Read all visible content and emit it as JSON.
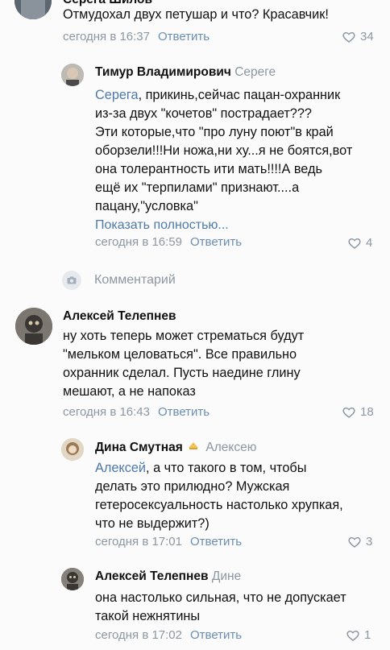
{
  "c1": {
    "author": "Серега Шилов",
    "text": "Отмудохал двух петушар и что? Красавчик!",
    "time": "сегодня в 16:37",
    "reply_label": "Ответить",
    "likes": "34"
  },
  "c2": {
    "author": "Тимур Владимирович",
    "reply_to": "Сереге",
    "mention": "Серега",
    "text_lines": [
      ", прикинь,сейчас пацан-охранник",
      "из-за двух \"кочетов\" пострадает???",
      "Эти которые,что \"про луну поют\"в край",
      "оборзели!!!Ни ножа,ни ху...я не боятся,вот",
      "она толерантность ити мать!!!!А ведь",
      "ещё их \"терпилами\" признают....а",
      "пацану,\"условка\""
    ],
    "show_more": "Показать полностью...",
    "time": "сегодня в 16:59",
    "reply_label": "Ответить",
    "likes": "4"
  },
  "comment_link": "Комментарий",
  "c3": {
    "author": "Алексей Телепнев",
    "text_lines": [
      "ну хоть теперь может стрематься будут",
      "\"мельком целоваться\". Все правильно",
      "охранник сделал. Пусть наедине глину",
      "мешают, а не напоказ"
    ],
    "time": "сегодня в 16:43",
    "reply_label": "Ответить",
    "likes": "18"
  },
  "c4": {
    "author": "Дина Смутная",
    "reply_to": "Алексею",
    "mention": "Алексей",
    "text_lines": [
      ", а что такого в том, чтобы",
      "делать это прилюдно? Мужская",
      "гетеросексуальность настолько хрупкая,",
      "что не выдержит?)"
    ],
    "time": "сегодня в 17:01",
    "reply_label": "Ответить",
    "likes": "3"
  },
  "c5": {
    "author": "Алексей Телепнев",
    "reply_to": "Дине",
    "text_lines": [
      "она настолько сильная, что не допускает",
      "такой нежнятины"
    ],
    "time": "сегодня в 17:02",
    "reply_label": "Ответить",
    "likes": "1"
  },
  "colors": {
    "link": "#4d7aaa",
    "meta": "#8c97a3",
    "background": "#fbfbfb"
  }
}
